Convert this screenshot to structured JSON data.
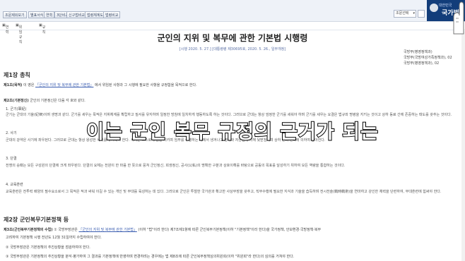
{
  "toolbar": {
    "buttons": [
      "조문제외보기",
      "별표서식",
      "연혁",
      "3단비교",
      "신구법비교",
      "법령체계도",
      "법령비교"
    ],
    "select_value": "조문선택"
  },
  "logo": {
    "subtitle": "대한민국",
    "name": "국가법"
  },
  "subbar": {
    "items": [
      "연혁",
      "위임규칙",
      "규칙"
    ]
  },
  "doc": {
    "title": "군인의 지위 및 복무에 관한 기본법 시행령",
    "meta": "[시행 2020. 5. 27.] [대통령령 제30695호, 2020. 5. 26., 일부개정]",
    "depts": [
      "국방부(병영정책과)",
      "국방부(국방여성가족정책과), 02",
      "국방부(병영정책과), 02"
    ],
    "chapter1": "제1장 총칙",
    "art1": {
      "head": "제1조(목적)",
      "text_a": "이 영은",
      "link": "「군인의 지위 및 복무에 관한 기본법」",
      "text_b": "에서 위임된 사항과 그 시행에 필요한 사항을 규정함을 목적으로 한다."
    },
    "art2": {
      "head": "제2조(기본정신)",
      "text": "군인의 기본정신은 다음 각 호와 같다."
    },
    "items": [
      {
        "label": "1. 군기(軍紀)",
        "text": "군기는 군대의 기율(紀律)이며 생명과 같다. 군기를 세우는 목적은 지휘체계를 확립하고 질서를 유지하며 일정한 방침에 일치하게 행동하도록 하는 것이다. 그러므로 군대는 항상 엄정한 군기를 세워야 하며 군기를 세우는 요결은 법규와 명령을 지키는 것이고 상하 동료 간에 존중하는 태도를 갖추는 것이다."
      },
      {
        "label": "2. 사기",
        "text": "군대의 강약은 사기에 좌우된다. 그러므로 군대는 항상 왕성한 사기를 유지해야 한다. 사기는 스스로 규율을 지키며 임무를 수행하는 데에서 생겨나고 명예와 자긍심에 의해 뒷받침되며 상하 간의 신뢰에 의하여 높아진다."
      },
      {
        "label": "3. 단결",
        "text": "전쟁의 승패는 모든 구성원의 단결에 크게 좌우된다. 단결의 요체는 전원이 한 마음 한 뜻으로 뭉쳐 군인정신, 희생정신, 공사(公私)의 명확한 구분과 상호이해를 바탕으로 공동의 목표를 달성하기 위하여 모든 역량을 통합하는 것이다."
      }
    ],
    "item4": {
      "label": "4. 교육훈련",
      "text": "교육훈련은 전투력 배양의 필수요소로서 그 목적은 적과 싸워 이길 수 있는 개인 및 부대를 육성하는 데 있다. 그러므로 군인은 투철한 국가관과 확고한 사상무장을 갖추고, 직무수행에 필요한 지식과 기술을 습득하며 전시전술(戰時戰術)을 연마하고 강인한 체력을 단련하여, 부대훈련에 힘써야 한다."
    },
    "chapter2": "제2장 군인복무기본정책 등",
    "art3": {
      "head": "제3조(군인복무기본정책의 수립)",
      "text_a": "① 국방부장관은",
      "link": "「군인의 지위 및 복무에 관한 기본법」",
      "text_b": "(이하 \"법\"이라 한다) 제7조제1항에 따른 군인복무기본정책(이하 \"기본정책\"이라 한다)을 국가정책, 안보환경·국방정책·복무"
    },
    "art3_line2": "고려하여 기본정책 시행 전년도 12월 31일까지 수립하여야 한다.",
    "art3_item2": "② 국방부장관은 기본정책의 추진상황을 점검하여야 한다.",
    "art3_item3": "③ 국방부장관은 기본정책의 추진상황을 분석·평가하여 그 결과를 기본정책에 반영하며 변경하려는 경우에는 법 제8조에 따른 군인복무정책심의위원회(이하 \"위원회\"라 한다)의 심의를 거쳐야 한다."
  },
  "caption": "이는 군인 복무 규정의 근거가 되는"
}
